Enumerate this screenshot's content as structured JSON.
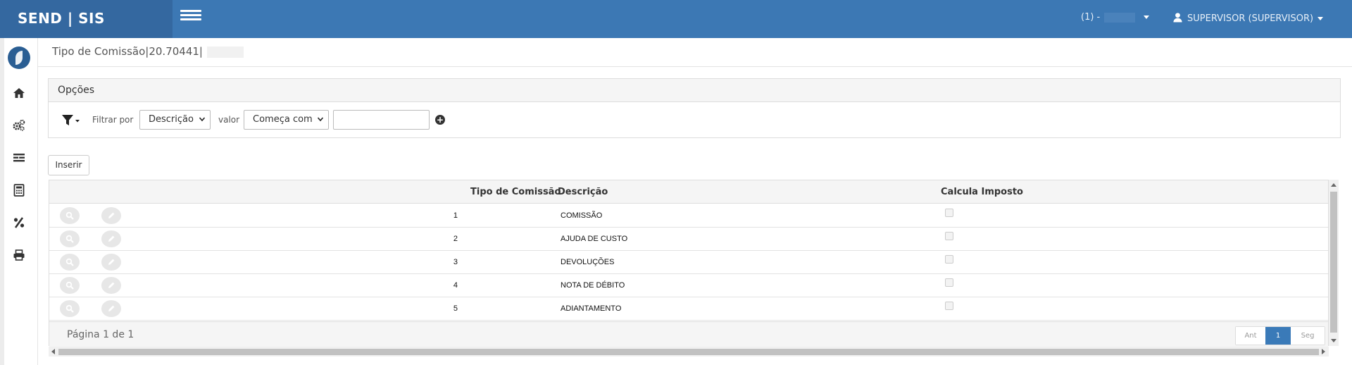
{
  "app": {
    "brand": "SEND | SIS"
  },
  "topbar": {
    "company_prefix": "(1) -",
    "user_label": "SUPERVISOR (SUPERVISOR)"
  },
  "sidebar": {
    "items": [
      {
        "icon": "home-icon"
      },
      {
        "icon": "gears-icon"
      },
      {
        "icon": "list-icon"
      },
      {
        "icon": "calculator-icon"
      },
      {
        "icon": "percent-icon"
      },
      {
        "icon": "print-icon"
      }
    ]
  },
  "breadcrumb": {
    "text": "Tipo de Comissão|20.70441|"
  },
  "options": {
    "title": "Opções",
    "filter_by_label": "Filtrar por",
    "filter_field": "Descrição",
    "value_label": "valor",
    "operator": "Começa com",
    "value": ""
  },
  "actions": {
    "insert_label": "Inserir"
  },
  "grid": {
    "columns": [
      "Tipo de Comissão",
      "Descrição",
      "Calcula Imposto"
    ],
    "rows": [
      {
        "id": "1",
        "desc": "COMISSÃO",
        "calc": false
      },
      {
        "id": "2",
        "desc": "AJUDA DE CUSTO",
        "calc": false
      },
      {
        "id": "3",
        "desc": "DEVOLUÇÕES",
        "calc": false
      },
      {
        "id": "4",
        "desc": "NOTA DE DÉBITO",
        "calc": false
      },
      {
        "id": "5",
        "desc": "ADIANTAMENTO",
        "calc": false
      }
    ],
    "page_info": "Página 1 de 1",
    "pager": {
      "prev": "Ant",
      "current": "1",
      "next": "Seg"
    }
  },
  "colors": {
    "topbar": "#3c78b4",
    "brand_bg": "#3468a0",
    "pager_active": "#3a7ab8"
  }
}
